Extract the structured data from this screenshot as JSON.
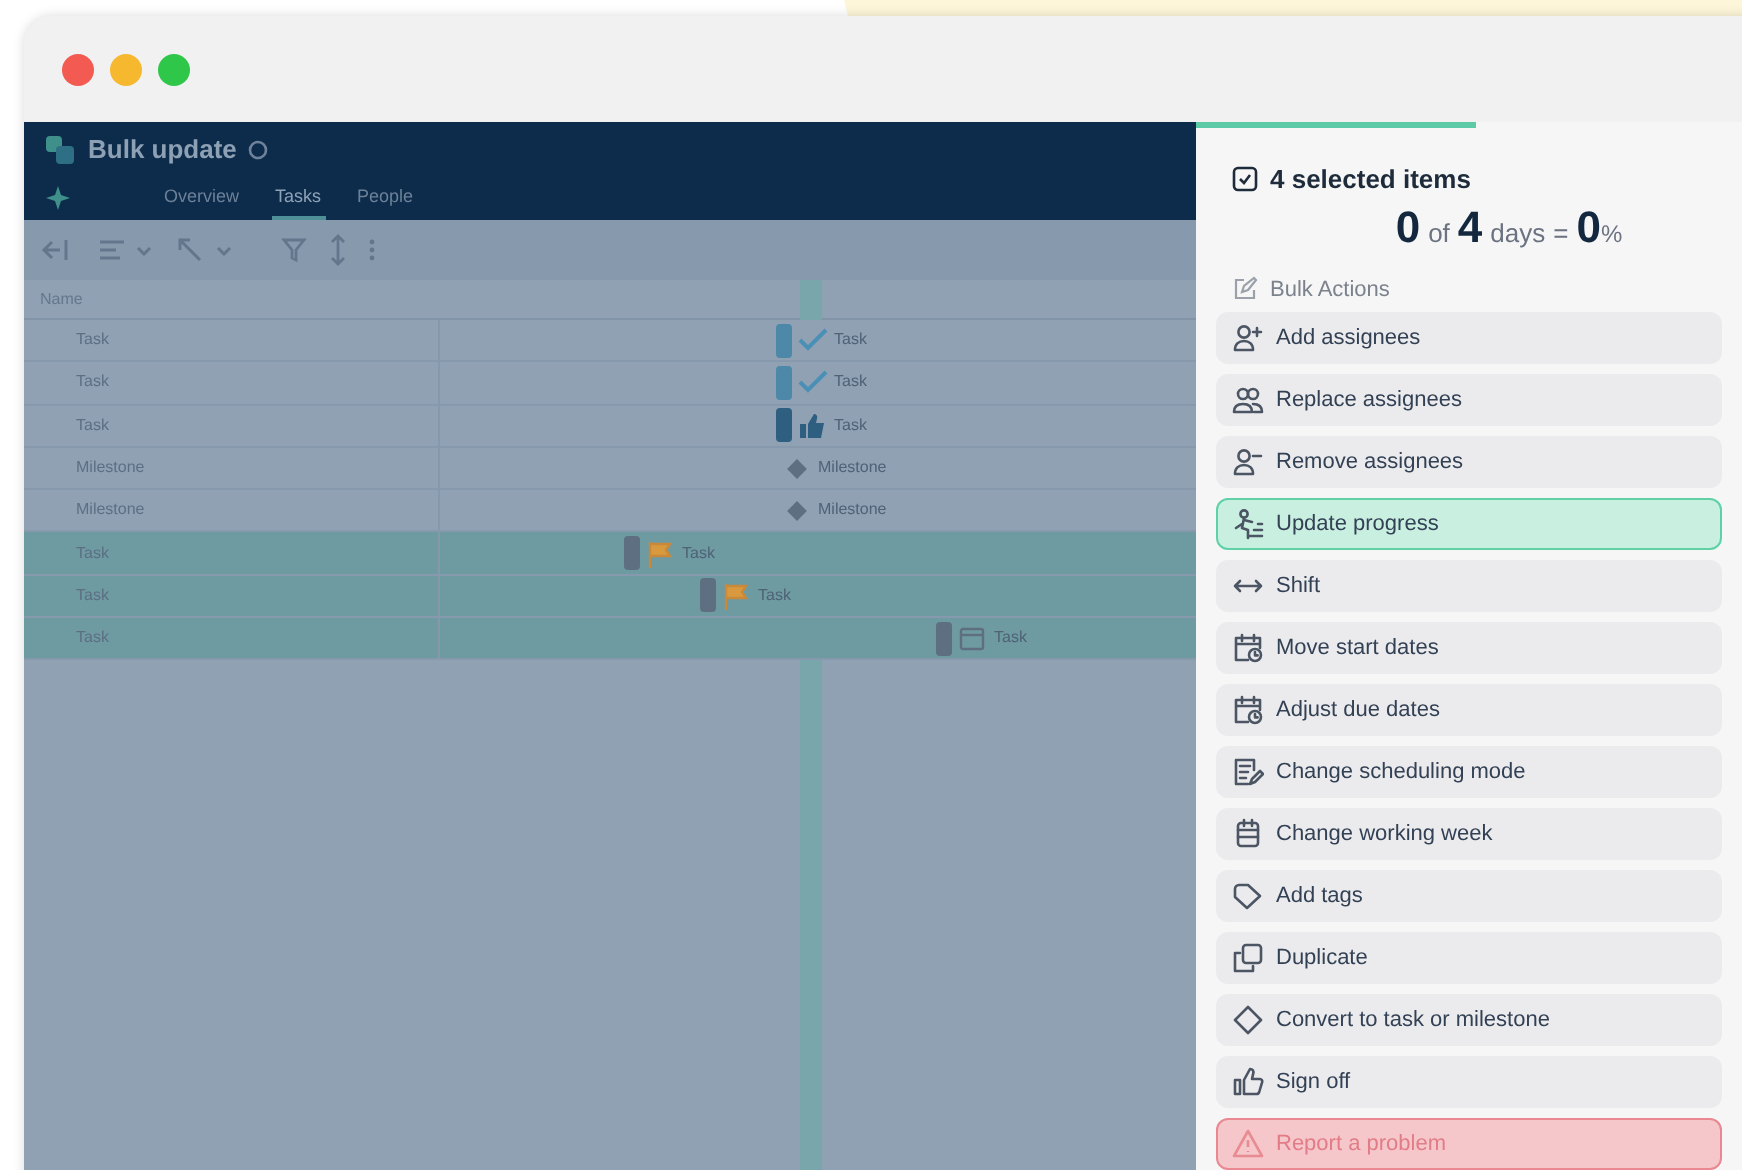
{
  "window": {
    "title": "Bulk update"
  },
  "tabs": [
    {
      "label": "Overview",
      "selected": false
    },
    {
      "label": "Tasks",
      "selected": true
    },
    {
      "label": "People",
      "selected": false
    }
  ],
  "gantt": {
    "name_column": "Name",
    "rows": [
      {
        "name": "Task",
        "selected": false,
        "bar": {
          "kind": "check",
          "label": "Task"
        }
      },
      {
        "name": "Task",
        "selected": false,
        "bar": {
          "kind": "check",
          "label": "Task"
        }
      },
      {
        "name": "Task",
        "selected": false,
        "bar": {
          "kind": "thumb",
          "label": "Task"
        }
      },
      {
        "name": "Milestone",
        "selected": false,
        "bar": {
          "kind": "milestone",
          "label": "Milestone"
        }
      },
      {
        "name": "Milestone",
        "selected": false,
        "bar": {
          "kind": "milestone",
          "label": "Milestone"
        }
      },
      {
        "name": "Task",
        "selected": true,
        "bar": {
          "kind": "flag",
          "label": "Task"
        }
      },
      {
        "name": "Task",
        "selected": true,
        "bar": {
          "kind": "flag",
          "label": "Task"
        }
      },
      {
        "name": "Task",
        "selected": true,
        "bar": {
          "kind": "calendar",
          "label": "Task"
        }
      }
    ]
  },
  "panel": {
    "title": "4 selected items",
    "summary": {
      "done": "0",
      "of": "of",
      "total": "4",
      "unit": "days",
      "equals": "=",
      "percent": "0",
      "percent_sign": "%"
    },
    "section": "Bulk Actions",
    "actions": [
      {
        "label": "Add assignees",
        "kind": "user-plus",
        "selected": false
      },
      {
        "label": "Replace assignees",
        "kind": "users",
        "selected": false
      },
      {
        "label": "Remove assignees",
        "kind": "user-minus",
        "selected": false
      },
      {
        "label": "Update progress",
        "kind": "progress",
        "selected": true
      },
      {
        "label": "Shift",
        "kind": "shift",
        "selected": false
      },
      {
        "label": "Move start dates",
        "kind": "calendar-clock",
        "selected": false
      },
      {
        "label": "Adjust due dates",
        "kind": "calendar-clock",
        "selected": false
      },
      {
        "label": "Change scheduling mode",
        "kind": "schedule",
        "selected": false
      },
      {
        "label": "Change working week",
        "kind": "calendar",
        "selected": false
      },
      {
        "label": "Add tags",
        "kind": "tag",
        "selected": false
      },
      {
        "label": "Duplicate",
        "kind": "copy",
        "selected": false
      },
      {
        "label": "Convert to task or milestone",
        "kind": "diamond",
        "selected": false
      },
      {
        "label": "Sign off",
        "kind": "thumb",
        "selected": false
      },
      {
        "label": "Report a problem",
        "kind": "danger",
        "selected": false
      }
    ]
  }
}
